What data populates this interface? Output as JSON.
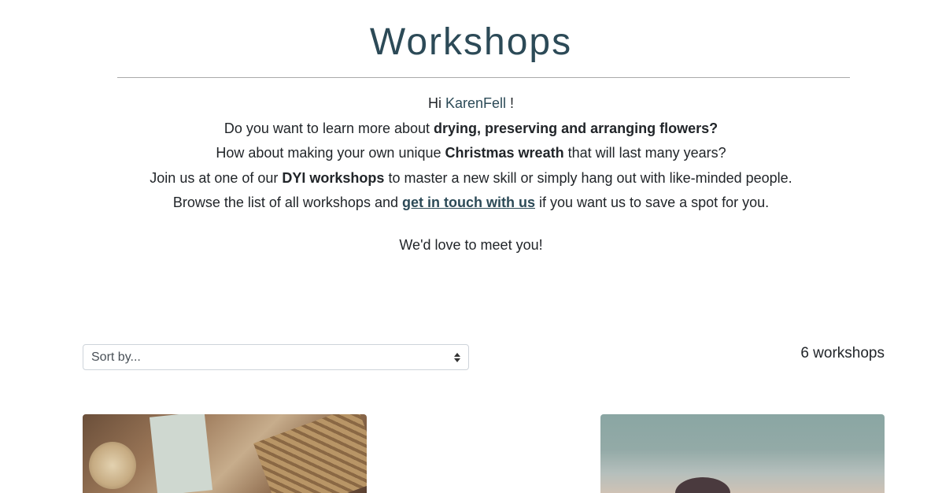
{
  "page": {
    "title": "Workshops"
  },
  "intro": {
    "greeting_prefix": "Hi",
    "username": "KarenFell",
    "greeting_suffix": "!",
    "line2_prefix": "Do you want to learn more about ",
    "line2_bold": "drying, preserving and arranging flowers?",
    "line3_prefix": "How about making your own unique ",
    "line3_bold": "Christmas wreath",
    "line3_suffix": " that will last many years?",
    "line4_prefix": "Join us at one of our ",
    "line4_bold": "DYI workshops",
    "line4_suffix": " to master a new skill or simply hang out with like-minded people.",
    "line5_prefix": "Browse the list of all workshops and ",
    "line5_link": "get in touch with us",
    "line5_suffix": " if you want us to save a spot for you.",
    "closing": "We'd love to meet you!"
  },
  "controls": {
    "sort_selected": "Sort by...",
    "workshop_count": "6 workshops"
  },
  "colors": {
    "accent": "#2c4a57",
    "text": "#212529",
    "rule": "#a9a9a9"
  }
}
